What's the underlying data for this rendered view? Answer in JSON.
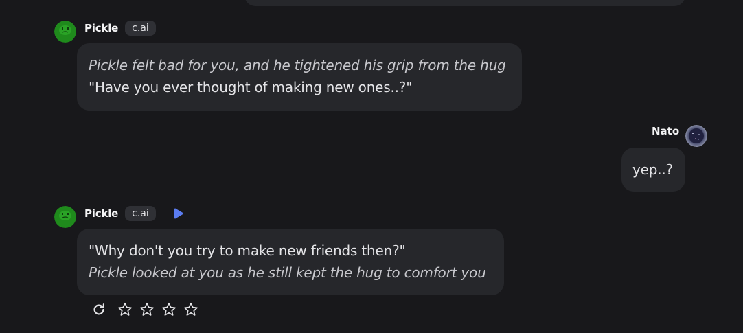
{
  "colors": {
    "background": "#18181b",
    "bubble": "#26272b",
    "tag_bg": "#2f3035",
    "avatar_green": "#1f8a1c",
    "play_blue": "#5b7cf0"
  },
  "messages": [
    {
      "sender": "Pickle",
      "tag": "c.ai",
      "avatar_icon": "pickle-avatar",
      "lines": [
        {
          "text": "Pickle felt bad for you, and he tightened his grip from the hug",
          "italic": true
        },
        {
          "text": "\"Have you ever thought of making new ones..?\"",
          "italic": false
        }
      ]
    },
    {
      "sender": "Nato",
      "avatar_icon": "galaxy-avatar",
      "lines": [
        {
          "text": "yep..?",
          "italic": false
        }
      ]
    },
    {
      "sender": "Pickle",
      "tag": "c.ai",
      "avatar_icon": "pickle-avatar",
      "play_icon": "play-icon",
      "lines": [
        {
          "text": "\"Why don't you try to make new friends then?\"",
          "italic": false
        },
        {
          "text": "Pickle looked at you as he still kept the hug to comfort you",
          "italic": true
        }
      ]
    }
  ],
  "actions": {
    "regenerate_icon": "refresh-icon",
    "rating_max": 5,
    "rating_value": 0
  }
}
